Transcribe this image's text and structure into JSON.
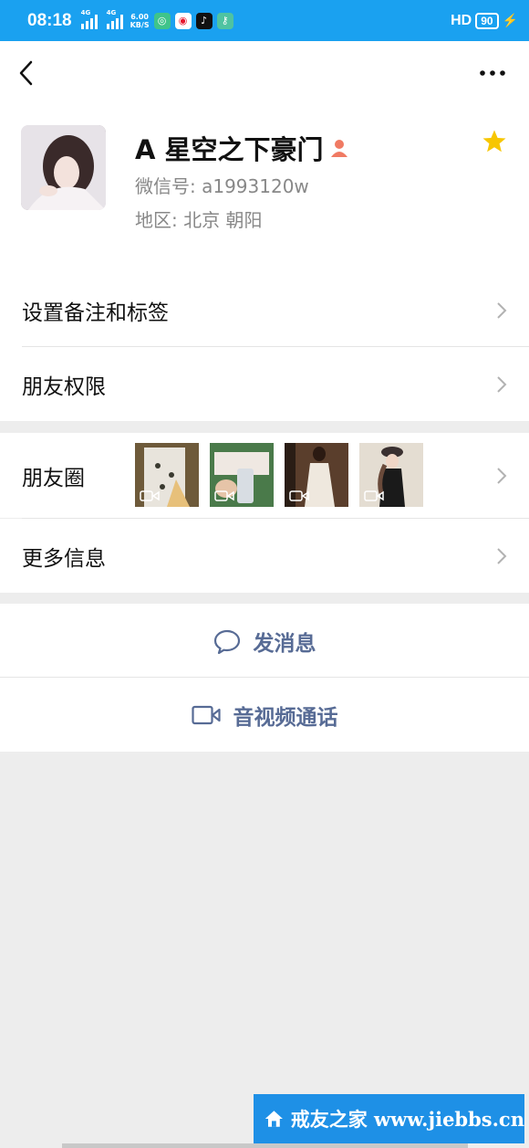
{
  "status_bar": {
    "time": "08:18",
    "network_tag_1": "4G",
    "network_tag_2": "4G",
    "net_speed_value": "6.00",
    "net_speed_unit": "KB/S",
    "hd_label": "HD",
    "battery": "90"
  },
  "profile": {
    "nickname": "A 星空之下豪门",
    "wechat_id": "微信号: a1993120w",
    "region": "地区: 北京  朝阳"
  },
  "rows": {
    "remark_tags": "设置备注和标签",
    "permissions": "朋友权限",
    "moments": "朋友圈",
    "more_info": "更多信息"
  },
  "actions": {
    "send_message": "发消息",
    "video_call": "音视频通话"
  },
  "watermark": {
    "text": "戒友之家 www.jiebbs.cn"
  },
  "colors": {
    "status_bar": "#1aa1f0",
    "link_blue": "#576b95",
    "star": "#f7c600",
    "gender_female": "#f07a63"
  }
}
